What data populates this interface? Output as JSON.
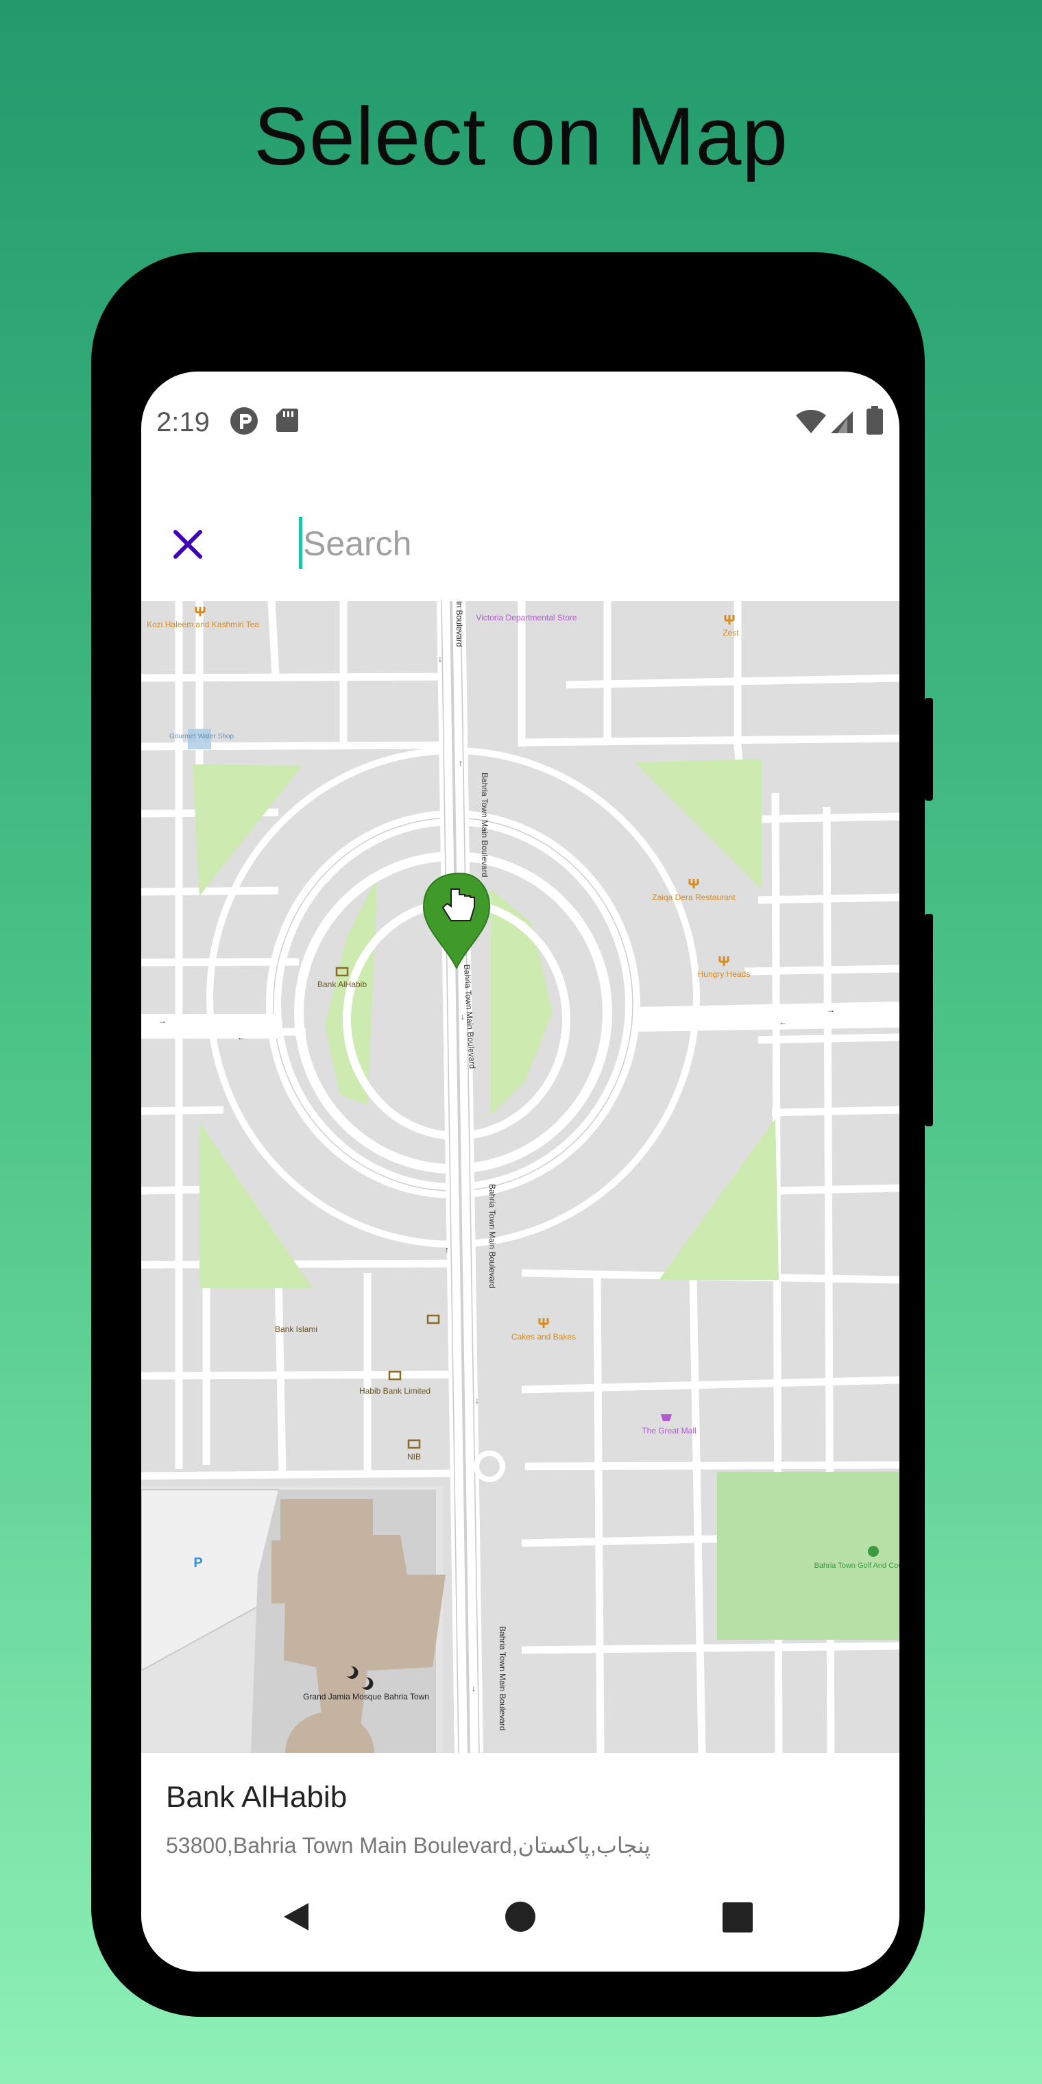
{
  "headline": "Select on Map",
  "status_bar": {
    "time": "2:19",
    "icons": [
      "app-notification-icon",
      "sd-card-icon",
      "wifi-icon",
      "cellular-signal-icon",
      "battery-icon"
    ]
  },
  "search": {
    "placeholder": "Search",
    "value": "",
    "close_icon": "close-icon"
  },
  "map": {
    "pin_icon": "hand-pointer-map-pin-icon",
    "labels": {
      "victoria_store": "Victoria Departmental Store",
      "zest": "Zest",
      "kozi_haleem": "Kozi Haleem and Kashmiri Tea",
      "gourmet_water": "Gourmet Water Shop",
      "zaiqa_dera": "Zaiqa Dera Restaurant",
      "hungry_heads": "Hungry Heads",
      "bank_alhabib": "Bank AlHabib",
      "bank_islami": "Bank Islami",
      "cakes_bakes": "Cakes and Bakes",
      "habib_bank": "Habib Bank Limited",
      "nib": "NIB",
      "great_mall": "The Great Mall",
      "golf_club": "Bahria Town Golf And Country Club",
      "parking": "P",
      "grand_mosque": "Grand Jamia Mosque Bahria Town",
      "road_1": "Bahria Town Main Boulevard",
      "road_2": "Bahria Town Main Boulevard",
      "road_3": "Bahria Town Main Boulevard",
      "road_4": "Bahria Town Main Boulevard",
      "road_5": "in Boulevard"
    }
  },
  "selected_place": {
    "title": "Bank AlHabib",
    "address": "53800,Bahria Town Main Boulevard,پنجاب,پاکستان"
  },
  "nav_bar": {
    "icons": [
      "back-icon",
      "home-icon",
      "recents-icon"
    ]
  },
  "colors": {
    "background_top": "#229a6c",
    "background_bottom": "#8ef0b6",
    "close_icon": "#3d00b8",
    "cursor": "#1ec3a8",
    "pin": "#3f9a2a",
    "park": "#cdeab0",
    "building": "#c5b3a2"
  }
}
